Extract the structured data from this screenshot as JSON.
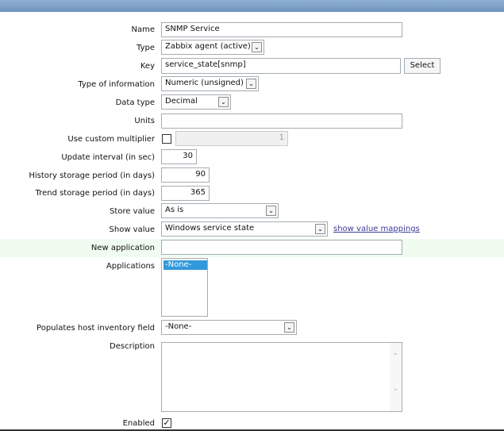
{
  "form": {
    "name": {
      "label": "Name",
      "value": "SNMP Service"
    },
    "type": {
      "label": "Type",
      "value": "Zabbix agent (active)"
    },
    "key": {
      "label": "Key",
      "value": "service_state[snmp]",
      "button": "Select"
    },
    "type_of_information": {
      "label": "Type of information",
      "value": "Numeric (unsigned)"
    },
    "data_type": {
      "label": "Data type",
      "value": "Decimal"
    },
    "units": {
      "label": "Units",
      "value": ""
    },
    "custom_multiplier": {
      "label": "Use custom multiplier",
      "checked": false,
      "value": "1"
    },
    "update_interval": {
      "label": "Update interval (in sec)",
      "value": "30"
    },
    "history": {
      "label": "History storage period (in days)",
      "value": "90"
    },
    "trend": {
      "label": "Trend storage period (in days)",
      "value": "365"
    },
    "store_value": {
      "label": "Store value",
      "value": "As is"
    },
    "show_value": {
      "label": "Show value",
      "value": "Windows service state",
      "link": "show value mappings"
    },
    "new_application": {
      "label": "New application",
      "value": ""
    },
    "applications": {
      "label": "Applications",
      "options": [
        "-None-"
      ]
    },
    "inventory": {
      "label": "Populates host inventory field",
      "value": "-None-"
    },
    "description": {
      "label": "Description",
      "value": ""
    },
    "enabled": {
      "label": "Enabled",
      "checked": true,
      "mark": "✓"
    }
  },
  "icons": {
    "chevron": "⌄",
    "up": "⌃",
    "down": "⌄"
  }
}
